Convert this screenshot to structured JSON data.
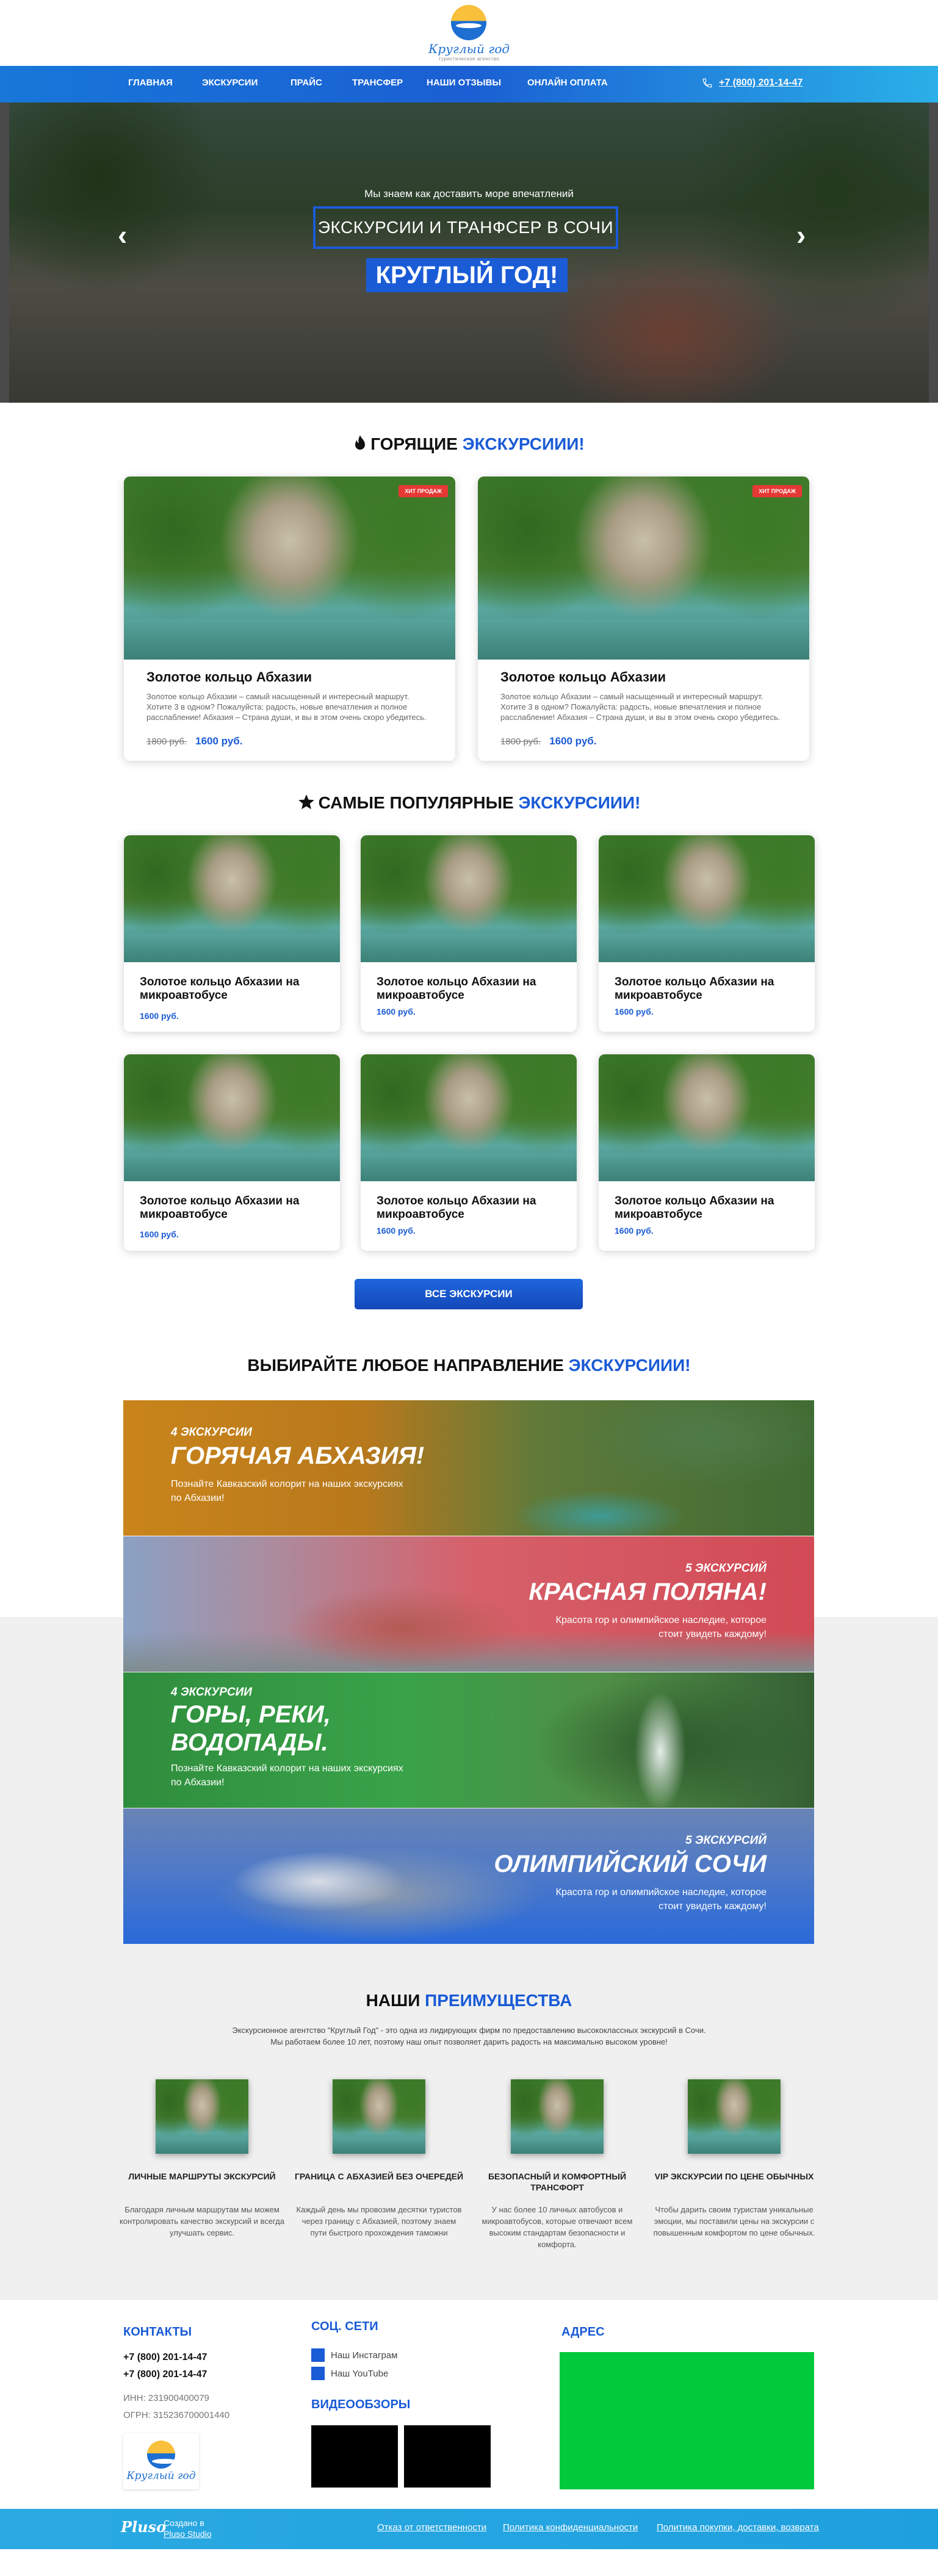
{
  "header": {
    "logo_text": "Круглый год",
    "logo_sub": "туристическое агенство"
  },
  "nav": {
    "items": [
      "Главная",
      "Экскурсии",
      "Прайс",
      "Трансфер",
      "Наши отзывы",
      "Онлайн оплата"
    ],
    "phone": "+7 (800) 201-14-47"
  },
  "hero": {
    "subtitle": "Мы знаем как доставить море впечатлений",
    "box_text": "ЭКСКУРСИИ И ТРАНФСЕР В СОЧИ",
    "big_text": "КРУГЛЫЙ ГОД!",
    "prev_arrow": "‹",
    "next_arrow": "›"
  },
  "hot": {
    "title_black": "Горящие",
    "title_blue": "экскурсиии!",
    "cards": [
      {
        "badge": "ХИТ ПРОДАЖ",
        "title": "Золотое кольцо Абхазии",
        "desc": "Золотое кольцо Абхазии – самый насыщенный и интересный маршрут. Хотите 3 в одном? Пожалуйста: радость, новые впечатления и полное расслабление! Абхазия – Страна души, и вы в этом очень скоро убедитесь.",
        "old_price": "1800 руб.",
        "price": "1600 руб."
      },
      {
        "badge": "ХИТ ПРОДАЖ",
        "title": "Золотое кольцо Абхазии",
        "desc": "Золотое кольцо Абхазии – самый насыщенный и интересный маршрут. Хотите 3 в одном? Пожалуйста: радость, новые впечатления и полное расслабление! Абхазия – Страна души, и вы в этом очень скоро убедитесь.",
        "old_price": "1800 руб.",
        "price": "1600 руб."
      }
    ]
  },
  "popular": {
    "title_black": "Самые популярные",
    "title_blue": "экскурсиии!",
    "cards": [
      {
        "title": "Золотое кольцо Абхазии на микроавтобусе",
        "price": "1600 руб."
      },
      {
        "title": "Золотое кольцо Абхазии на микроавтобусе",
        "price": "1600 руб."
      },
      {
        "title": "Золотое кольцо Абхазии на микроавтобусе",
        "price": "1600 руб."
      },
      {
        "title": "Золотое кольцо Абхазии на микроавтобусе",
        "price": "1600 руб."
      },
      {
        "title": "Золотое кольцо Абхазии на микроавтобусе",
        "price": "1600 руб."
      },
      {
        "title": "Золотое кольцо Абхазии на микроавтобусе",
        "price": "1600 руб."
      }
    ],
    "all_button": "Все экскурсии"
  },
  "directions": {
    "title_black": "Выбирайте любое направление",
    "title_blue": "экскурсиии!",
    "items": [
      {
        "count": "4 экскурсии",
        "name": "Горячая Абхазия!",
        "desc": "Познайте Кавказский колорит на наших экскурсиях по Абхазии!"
      },
      {
        "count": "5 экскурсий",
        "name": "Красная поляна!",
        "desc": "Красота гор и олимпийское наследие, которое стоит увидеть каждому!"
      },
      {
        "count": "4 экскурсии",
        "name": "Горы, реки, водопады.",
        "desc": "Познайте Кавказский колорит на наших экскурсиях по Абхазии!"
      },
      {
        "count": "5 экскурсий",
        "name": "Олимпийский Сочи",
        "desc": "Красота гор и олимпийское наследие, которое стоит увидеть каждому!"
      }
    ]
  },
  "advantages": {
    "title_black": "Наши",
    "title_blue": "преимущества",
    "intro": "Экскурсионное агентство \"Круглый Год\" - это одна из лидирующих фирм по предоставлению высококлассных экскурсий в Сочи. Мы работаем более 10 лет, поэтому наш опыт позволяет дарить радость на максимально высоком уровне!",
    "items": [
      {
        "title": "Личные маршруты экскурсий",
        "text": "Благодаря личным маршрутам мы можем контролировать качество экскурсий и всегда улучшать сервис."
      },
      {
        "title": "Граница с Абхазией без очередей",
        "text": "Каждый день мы провозим десятки туристов через границу с Абхазией, поэтому знаем пути быстрого прохождения таможни"
      },
      {
        "title": "Безопасный и комфортный трансфорт",
        "text": "У нас более 10 личных автобусов и микроавтобусов, которые отвечают всем высоким стандартам безопасности и комфорта."
      },
      {
        "title": "VIP экскурсии по цене обычных",
        "text": "Чтобы дарить своим туристам уникальные эмоции, мы поставили цены на экскурсии с повышенным комфортом по цене обычных."
      }
    ]
  },
  "footer": {
    "contacts_title": "Контакты",
    "phone1": "+7 (800) 201-14-47",
    "phone2": "+7 (800) 201-14-47",
    "inn": "ИНН: 231900400079",
    "ogrn": "ОГРН: 315236700001440",
    "social_title": "Соц. сети",
    "instagram": "Наш Инстаграм",
    "youtube": "Наш YouTube",
    "video_title": "Видеообзоры",
    "address_title": "Адрес",
    "pluso": "Pluso",
    "created_line1": "Создано в",
    "created_line2": "Pluso Studio",
    "links": [
      "Отказ от ответственности",
      "Политика конфиденциальности",
      "Политика покупки, доставки, возврата"
    ]
  },
  "colors": {
    "accent": "#1a5bd6",
    "nav_start": "#1877d9",
    "nav_end": "#2ab0e8",
    "hit_badge": "#e53935",
    "map": "#02c93c"
  }
}
